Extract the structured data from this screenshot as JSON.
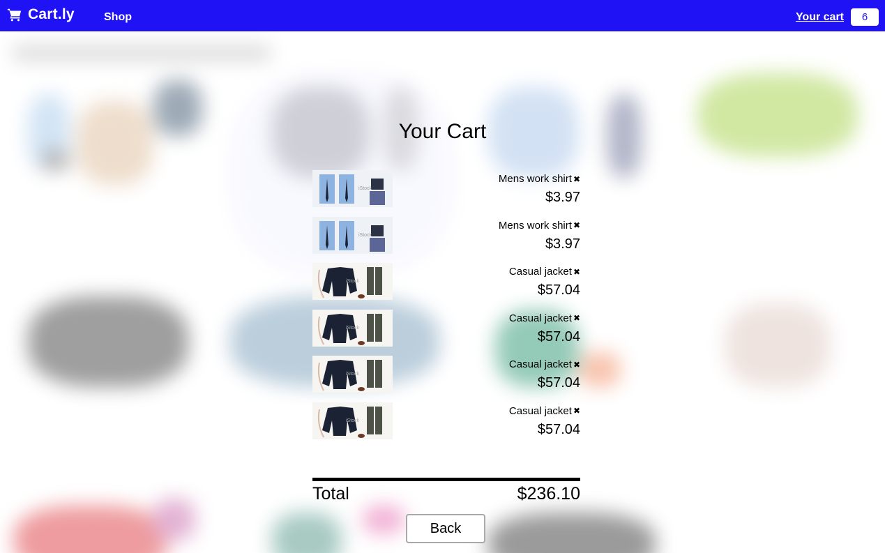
{
  "brand": {
    "name": "Cart.ly",
    "icon": "shopping-cart-icon"
  },
  "nav": {
    "shop": "Shop",
    "your_cart": "Your cart",
    "cart_count": "6"
  },
  "colors": {
    "nav_background": "#1f12f5",
    "text": "#000000"
  },
  "cart": {
    "title": "Your Cart",
    "items": [
      {
        "name": "Mens work shirt",
        "price": "$3.97",
        "remove": "✖",
        "thumbnail": "shirt-ties"
      },
      {
        "name": "Mens work shirt",
        "price": "$3.97",
        "remove": "✖",
        "thumbnail": "shirt-ties"
      },
      {
        "name": "Casual jacket",
        "price": "$57.04",
        "remove": "✖",
        "thumbnail": "jacket-outfit"
      },
      {
        "name": "Casual jacket",
        "price": "$57.04",
        "remove": "✖",
        "thumbnail": "jacket-outfit"
      },
      {
        "name": "Casual jacket",
        "price": "$57.04",
        "remove": "✖",
        "thumbnail": "jacket-outfit"
      },
      {
        "name": "Casual jacket",
        "price": "$57.04",
        "remove": "✖",
        "thumbnail": "jacket-outfit"
      }
    ],
    "total_label": "Total",
    "total_value": "$236.10",
    "back_label": "Back"
  }
}
